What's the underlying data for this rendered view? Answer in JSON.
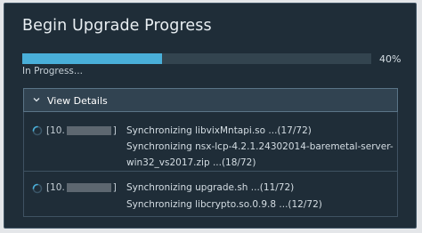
{
  "dialog": {
    "title": "Begin Upgrade Progress",
    "progress": {
      "percent_label": "40%",
      "fraction": 0.4,
      "status": "In Progress..."
    },
    "details_toggle": {
      "label": "View Details",
      "expanded": true
    },
    "rows": [
      {
        "host_prefix": "[10.",
        "host_suffix": "]",
        "lines": [
          "Synchronizing libvixMntapi.so ...(17/72)",
          "Synchronizing nsx-lcp-4.2.1.24302014-baremetal-server-",
          "win32_vs2017.zip ...(18/72)"
        ]
      },
      {
        "host_prefix": "[10.",
        "host_suffix": "]",
        "lines": [
          "Synchronizing upgrade.sh ...(11/72)",
          "Synchronizing libcrypto.so.0.9.8 ...(12/72)"
        ]
      }
    ]
  },
  "colors": {
    "background": "#1f2d38",
    "progress_fill": "#49afd9",
    "progress_track": "#33444f",
    "spinner": "#49afd9"
  },
  "icons": {
    "toggle": "chevron-down-icon",
    "row_status": "spinner-icon"
  }
}
